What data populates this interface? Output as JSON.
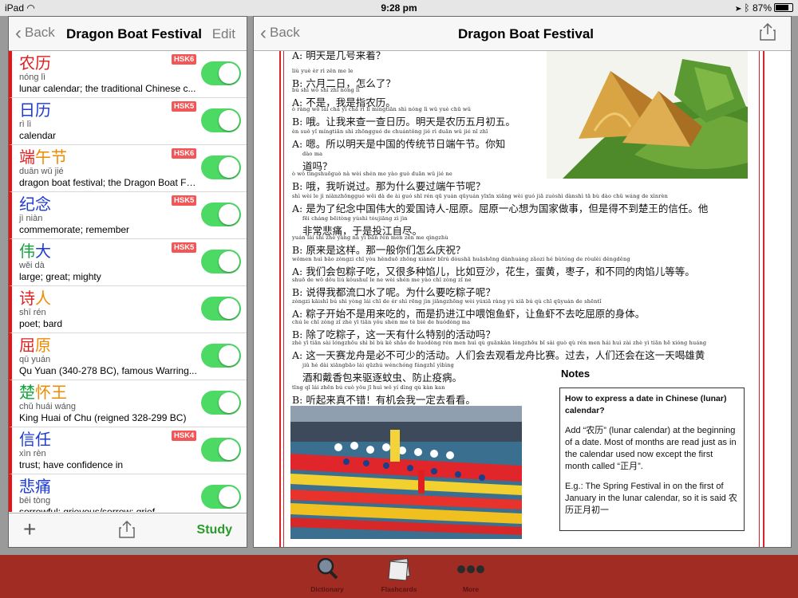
{
  "status_bar": {
    "device": "iPad",
    "time": "9:28 pm",
    "battery": "87%"
  },
  "left_pane": {
    "back_label": "Back",
    "title": "Dragon Boat Festival",
    "edit_label": "Edit",
    "study_label": "Study",
    "vocab": [
      {
        "chars": [
          {
            "t": "农",
            "c": "red"
          },
          {
            "t": "历",
            "c": "red"
          }
        ],
        "pinyin": "nóng lì",
        "definition": "lunar calendar; the traditional Chinese c...",
        "hsk": "HSK6"
      },
      {
        "chars": [
          {
            "t": "日",
            "c": "blue"
          },
          {
            "t": "历",
            "c": "blue"
          }
        ],
        "pinyin": "rì lì",
        "definition": "calendar",
        "hsk": "HSK5"
      },
      {
        "chars": [
          {
            "t": "端",
            "c": "red"
          },
          {
            "t": "午",
            "c": "orange"
          },
          {
            "t": "节",
            "c": "orange"
          }
        ],
        "pinyin": "duān wǔ jié",
        "definition": "dragon boat festival; the Dragon Boat Fe...",
        "hsk": "HSK6"
      },
      {
        "chars": [
          {
            "t": "纪",
            "c": "blue"
          },
          {
            "t": "念",
            "c": "blue"
          }
        ],
        "pinyin": "jì niàn",
        "definition": "commemorate; remember",
        "hsk": "HSK5"
      },
      {
        "chars": [
          {
            "t": "伟",
            "c": "green"
          },
          {
            "t": "大",
            "c": "blue"
          }
        ],
        "pinyin": "wěi dà",
        "definition": "large; great; mighty",
        "hsk": "HSK5"
      },
      {
        "chars": [
          {
            "t": "诗",
            "c": "red"
          },
          {
            "t": "人",
            "c": "orange"
          }
        ],
        "pinyin": "shī rén",
        "definition": "poet; bard",
        "hsk": ""
      },
      {
        "chars": [
          {
            "t": "屈",
            "c": "red"
          },
          {
            "t": "原",
            "c": "orange"
          }
        ],
        "pinyin": "qū yuán",
        "definition": "Qu Yuan (340-278 BC), famous Warring...",
        "hsk": ""
      },
      {
        "chars": [
          {
            "t": "楚",
            "c": "green"
          },
          {
            "t": "怀",
            "c": "orange"
          },
          {
            "t": "王",
            "c": "orange"
          }
        ],
        "pinyin": "chǔ huái wáng",
        "definition": "King Huai of Chu (reigned 328-299 BC)",
        "hsk": ""
      },
      {
        "chars": [
          {
            "t": "信",
            "c": "blue"
          },
          {
            "t": "任",
            "c": "blue"
          }
        ],
        "pinyin": "xìn rèn",
        "definition": "trust; have confidence in",
        "hsk": "HSK4"
      },
      {
        "chars": [
          {
            "t": "悲",
            "c": "blue"
          },
          {
            "t": "痛",
            "c": "blue"
          }
        ],
        "pinyin": "bēi tòng",
        "definition": "sorrowful; grievous/sorrow; grief",
        "hsk": ""
      }
    ]
  },
  "right_pane": {
    "back_label": "Back",
    "title": "Dragon Boat Festival",
    "dialogue": [
      {
        "pinyin": "",
        "text": "A: 明天是几号来着？"
      },
      {
        "pinyin": "liù yuè èr rì      zěn me le",
        "text": "B: 六月二日，怎么了？"
      },
      {
        "pinyin": "bú shì      wǒ shì zhǐ nóng lì",
        "text": "A: 不是，我是指农历。"
      },
      {
        "pinyin": "ò      ràng wǒ lái chá yi chá rì lì      míngtiān shì nóng lì wǔ yuè chū wǔ",
        "text": "B: 哦。让我来查一查日历。明天是农历五月初五。"
      },
      {
        "pinyin": "èn      suǒ yǐ míngtiān shì zhōngguó de chuántǒng jié rì duān wǔ jié      nǐ zhī",
        "text": "A: 嗯。所以明天是中国的传统节日端午节。你知",
        "cont": "道吗？",
        "cont_pinyin": "dào ma"
      },
      {
        "pinyin": "ò      wǒ tīngshuōguò      nà wèi shén me yào guò duān wǔ jié ne",
        "text": "B: 哦，我听说过。那为什么要过端午节呢？"
      },
      {
        "pinyin": "shì wèi le jì niànzhōngguó wěi dà de ài guó shī rén qū yuán      qūyuán yīxīn xiǎng wèi guó jiā zuòshì      dànshì tā bù dào chǔ wáng de xìnrèn",
        "text": "A: 是为了纪念中国伟大的爱国诗人-屈原。屈原一心想为国家做事，但是得不到楚王的信任。他",
        "cont": "非常悲痛，于是投江自尽。",
        "cont_pinyin": "fēi cháng bēitòng      yúshì tóujiāng zì jìn"
      },
      {
        "pinyin": "yuán lái shì zhè yàng      nà yì bān rén men zěn me qìngzhù",
        "text": "B: 原来是这样。那一般你们怎么庆祝？"
      },
      {
        "pinyin": "wǒmen huì bāo zòngzi chī      yòu hěnduō zhǒng xiànér      bǐrú dòushā      huāshēng      dànhuáng      zǎozi      hé bùtóng de ròulèi děngděng",
        "text": "A: 我们会包粽子吃，又很多种馅儿，比如豆沙，花生，蛋黄，枣子，和不同的肉馅儿等等。"
      },
      {
        "pinyin": "shuō de wǒ dōu liú kǒushuǐ le ne      wèi shén me yào chī zòng zǐ ne",
        "text": "B: 说得我都流口水了呢。为什么要吃粽子呢？"
      },
      {
        "pinyin": "zòngzi kāishǐ bú shì yòng lái chī de      ér shì rēng jìn jiāngzhōng wèi yúxiā      ràng yú xiā bú qù chī qūyuán de shēntǐ",
        "text": "A: 粽子开始不是用来吃的，而是扔进江中喂饱鱼虾，让鱼虾不去吃屈原的身体。"
      },
      {
        "pinyin": "chú le chī zòng zǐ      zhè yī tiān yǒu shén me tè bié de huódòng ma",
        "text": "B: 除了吃粽子，这一天有什么特别的活动吗？"
      },
      {
        "pinyin": "zhè yī tiān sài lóngzhōu shì bì bù kě shǎo de huódòng      rén men huì qù guānkàn lóngzhōu bǐ sài      guò qù      rén men hái huì zài zhè yì tiān hē xióng huáng",
        "text": "A: 这一天赛龙舟是必不可少的活动。人们会去观看龙舟比赛。过去，人们还会在这一天喝雄黄",
        "cont": "酒和戴香包来驱逐蚊虫、防止疫病。",
        "cont_pinyin": "jiǔ hé dài xiāngbāo lái qūzhú wénchóng      fángzhǐ yìbìng"
      },
      {
        "pinyin": "tīng qǐ lái zhēn bú cuò      yǒu jī huì wǒ yí dìng qù kàn kan",
        "text": "B: 听起来真不错！有机会我一定去看看。"
      }
    ],
    "notes": {
      "title": "Notes",
      "heading": "How to express a date in Chinese (lunar) calendar?",
      "para1": "Add “农历” (lunar calendar) at the beginning of a date. Most of months are read just as in the calendar used now except the first month called “正月”.",
      "para2": "E.g.: The Spring Festival in on the first of January in the lunar calendar, so it is said 农历正月初一"
    }
  },
  "tab_bar": {
    "items": [
      {
        "label": "Dictionary",
        "icon": "magnifier-icon"
      },
      {
        "label": "Flashcards",
        "icon": "flashcards-icon"
      },
      {
        "label": "More",
        "icon": "more-dots-icon"
      }
    ]
  },
  "colors": {
    "red": "#e11e1e",
    "orange": "#f08a00",
    "green": "#12a33c",
    "blue": "#1c3bd6",
    "toggle_on": "#4cd964",
    "hsk_badge": "#f25656",
    "tab_bar": "#a02c24"
  }
}
